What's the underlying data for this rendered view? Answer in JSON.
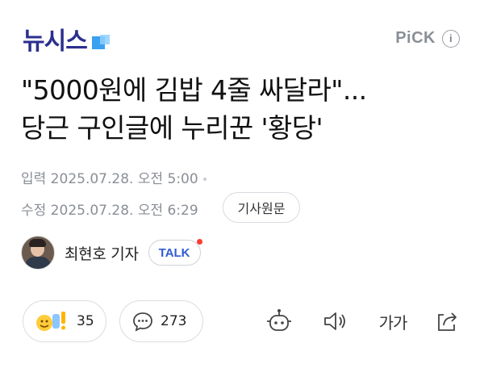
{
  "header": {
    "logo_text": "뉴시스",
    "pick_label": "PiCK",
    "info_icon_glyph": "i"
  },
  "headline": {
    "line1": "\"5000원에 김밥 4줄 싸달라\"...",
    "line2": "당근 구인글에 누리꾼 '황당'"
  },
  "meta": {
    "published": "입력 2025.07.28. 오전 5:00",
    "modified": "수정 2025.07.28. 오전 6:29",
    "original_button": "기사원문"
  },
  "author": {
    "name": "최현호 기자",
    "talk_label": "TALK"
  },
  "actions": {
    "reaction_count": "35",
    "comment_count": "273",
    "font_size_label": "가가",
    "icons": [
      "reaction-emoji-icon",
      "comment-icon",
      "robot-summary-icon",
      "speaker-icon",
      "font-size-icon",
      "share-icon"
    ]
  },
  "colors": {
    "logo": "#2b2f8f",
    "logo_accent": "#3aa1f0",
    "talk_blue": "#2f5bd3",
    "notification_red": "#ff3b30",
    "meta_gray": "#8a8f96"
  }
}
